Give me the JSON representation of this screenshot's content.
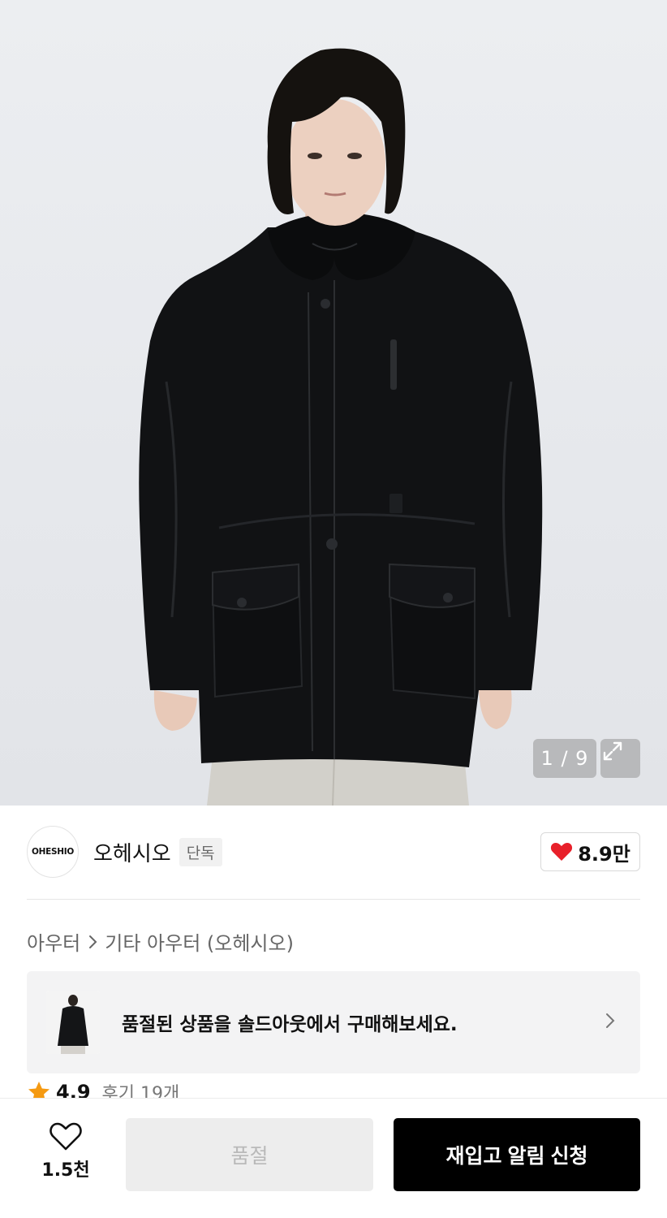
{
  "hero": {
    "image_counter": "1 / 9"
  },
  "brand": {
    "logo_text": "OHESHIO",
    "name": "오헤시오",
    "badge": "단독",
    "like_count": "8.9만"
  },
  "breadcrumb": {
    "items": [
      "아우터",
      "기타 아우터 (오헤시오)"
    ]
  },
  "banner": {
    "text": "품절된 상품을 솔드아웃에서 구매해보세요."
  },
  "rating": {
    "score": "4.9",
    "review_label": "후기 19개"
  },
  "bottom_bar": {
    "wish_count": "1.5천",
    "soldout_label": "품절",
    "restock_label": "재입고 알림 신청"
  },
  "colors": {
    "accent_heart": "#e8202a",
    "star": "#f59a12",
    "primary_button": "#000000"
  },
  "icons": [
    "expand-icon",
    "heart-filled-icon",
    "chevron-right-icon",
    "star-icon",
    "heart-outline-icon"
  ]
}
